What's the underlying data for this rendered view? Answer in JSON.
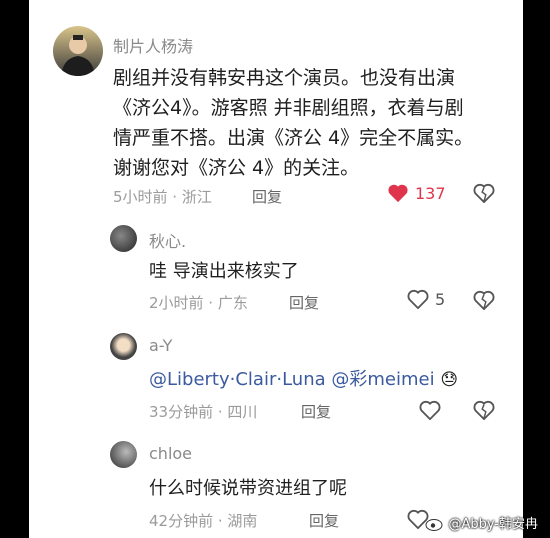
{
  "comments": [
    {
      "author": "制片人杨涛",
      "lines": [
        "剧组并没有韩安冉这个演员。也没有出演",
        "《济公4》。游客照 并非剧组照，衣着与剧",
        "情严重不搭。出演《济公 4》完全不属实。",
        "谢谢您对《济公 4》的关注。"
      ],
      "time": "5小时前 · 浙江",
      "reply_label": "回复",
      "like_count": "137",
      "liked": true
    },
    {
      "author": "秋心.",
      "text": "哇 导演出来核实了",
      "time": "2小时前 · 广东",
      "reply_label": "回复",
      "like_count": "5"
    },
    {
      "author": "a-Y",
      "mentions": [
        "@Liberty·Clair·Luna",
        "@彩meimei"
      ],
      "emoji": "😓",
      "time": "33分钟前 · 四川",
      "reply_label": "回复"
    },
    {
      "author": "chloe",
      "text": "什么时候说带资进组了呢",
      "time": "42分钟前 · 湖南",
      "reply_label": "回复"
    }
  ],
  "watermark": "@Abby-韩安冉",
  "colors": {
    "liked": "#e0344c",
    "mention": "#3c5aa0",
    "meta": "#9b9b9b"
  }
}
